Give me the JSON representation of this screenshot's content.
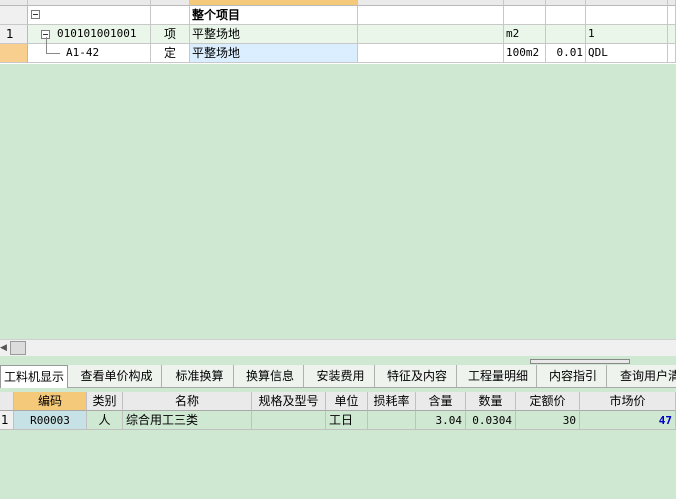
{
  "top_table": {
    "rows": [
      {
        "num": "",
        "code": "",
        "type": "",
        "name": "整个项目",
        "unit": "",
        "qty": "",
        "expr": ""
      },
      {
        "num": "1",
        "code": "010101001001",
        "type": "项",
        "name": "平整场地",
        "unit": "m2",
        "qty": "",
        "expr": "1"
      },
      {
        "num": "",
        "code": "A1-42",
        "type": "定",
        "name": "平整场地",
        "unit": "100m2",
        "qty": "0.01",
        "expr": "QDL"
      }
    ]
  },
  "tabs": [
    "工料机显示",
    "查看单价构成",
    "标准换算",
    "换算信息",
    "安装费用",
    "特征及内容",
    "工程量明细",
    "内容指引",
    "查询用户清"
  ],
  "bottom_table": {
    "headers": [
      "编码",
      "类别",
      "名称",
      "规格及型号",
      "单位",
      "损耗率",
      "含量",
      "数量",
      "定额价",
      "市场价"
    ],
    "rows": [
      {
        "num": "1",
        "code": "R00003",
        "cat": "人",
        "name": "综合用工三类",
        "spec": "",
        "unit": "工日",
        "loss": "",
        "content": "3.04",
        "qty": "0.0304",
        "base_price": "30",
        "market_price": "47"
      }
    ]
  },
  "colors": {
    "background": "#cfe8d2",
    "accent": "#f5c97a",
    "market_price": "#0000cc"
  }
}
